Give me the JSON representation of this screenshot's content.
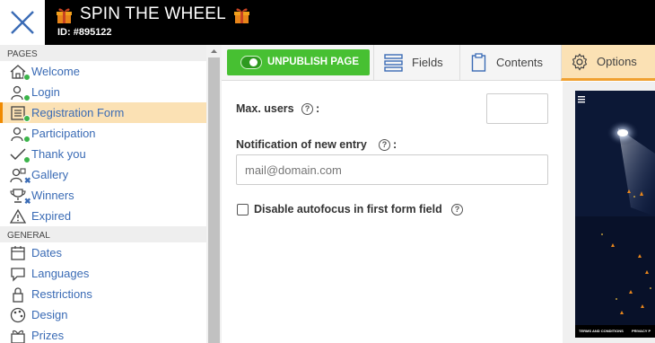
{
  "header": {
    "title": "SPIN THE WHEEL",
    "subtitle": "ID: #895122",
    "close_icon": "close-icon",
    "gift_icon": "gift-icon"
  },
  "sidebar": {
    "pages_header": "PAGES",
    "pages": [
      {
        "label": "Welcome",
        "icon": "home-icon",
        "status": "active"
      },
      {
        "label": "Login",
        "icon": "user-login-icon",
        "status": "active"
      },
      {
        "label": "Registration Form",
        "icon": "form-icon",
        "status": "active",
        "selected": true
      },
      {
        "label": "Participation",
        "icon": "participation-icon",
        "status": "active"
      },
      {
        "label": "Thank you",
        "icon": "check-icon",
        "status": "active"
      },
      {
        "label": "Gallery",
        "icon": "gallery-icon",
        "status": "disabled"
      },
      {
        "label": "Winners",
        "icon": "trophy-icon",
        "status": "disabled"
      },
      {
        "label": "Expired",
        "icon": "warning-icon",
        "status": "none"
      }
    ],
    "general_header": "GENERAL",
    "general": [
      {
        "label": "Dates",
        "icon": "calendar-icon"
      },
      {
        "label": "Languages",
        "icon": "speech-bubble-icon"
      },
      {
        "label": "Restrictions",
        "icon": "lock-icon"
      },
      {
        "label": "Design",
        "icon": "palette-icon"
      },
      {
        "label": "Prizes",
        "icon": "gift-outline-icon"
      }
    ]
  },
  "toolbar": {
    "unpublish_label": "UNPUBLISH PAGE",
    "tabs": [
      {
        "label": "Fields",
        "icon": "list-icon"
      },
      {
        "label": "Contents",
        "icon": "clipboard-icon"
      },
      {
        "label": "Options",
        "icon": "gear-icon",
        "active": true
      }
    ]
  },
  "form": {
    "max_users_label": "Max. users",
    "max_users_value": "",
    "notification_label": "Notification of new entry",
    "notification_value": "",
    "notification_placeholder": "mail@domain.com",
    "help_icon": "help-icon",
    "colon": ":",
    "help_glyph": "?",
    "disable_autofocus_label": "Disable autofocus in first form field",
    "disable_autofocus_checked": false
  },
  "preview": {
    "footer_left": "TERMS AND CONDITIONS",
    "footer_right": "PRIVACY P",
    "menu_icon": "hamburger-icon"
  },
  "colors": {
    "accent_green": "#47c032",
    "active_bg": "#fbe1b4",
    "active_bar": "#f08a00",
    "link_blue": "#3a6bb5",
    "status_green": "#3cb44b"
  }
}
